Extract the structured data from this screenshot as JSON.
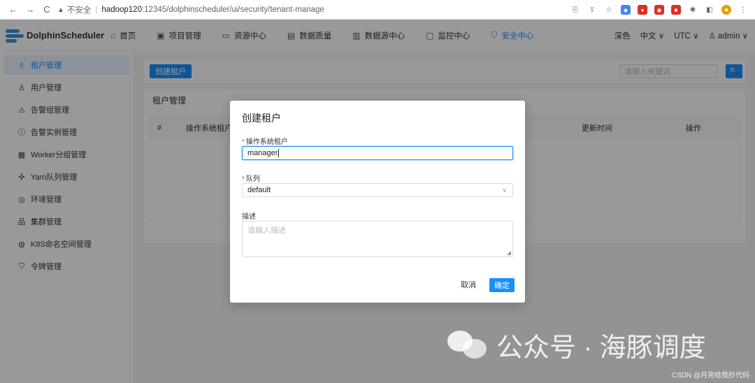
{
  "browser": {
    "back": "←",
    "forward": "→",
    "reload": "C",
    "warning_icon": "▲",
    "insecure_label": "不安全",
    "sep": "|",
    "host": "hadoop120",
    "path": ":12345/dolphinscheduler/ui/security/tenant-manage"
  },
  "header": {
    "logo": "DolphinScheduler",
    "nav": [
      {
        "icon": "home-icon",
        "glyph": "⌂",
        "label": "首页"
      },
      {
        "icon": "project-icon",
        "glyph": "▣",
        "label": "项目管理"
      },
      {
        "icon": "folder-icon",
        "glyph": "▭",
        "label": "资源中心"
      },
      {
        "icon": "quality-icon",
        "glyph": "▤",
        "label": "数据质量"
      },
      {
        "icon": "datasource-icon",
        "glyph": "▥",
        "label": "数据源中心"
      },
      {
        "icon": "monitor-icon",
        "glyph": "▢",
        "label": "监控中心"
      },
      {
        "icon": "shield-icon",
        "glyph": "⛉",
        "label": "安全中心"
      }
    ],
    "theme": "深色",
    "language": "中文",
    "timezone": "UTC",
    "user": "admin",
    "user_icon": "♙",
    "chevron": "∨"
  },
  "sidebar": {
    "items": [
      {
        "glyph": "♗",
        "label": "租户管理",
        "active": true
      },
      {
        "glyph": "♙",
        "label": "用户管理"
      },
      {
        "glyph": "⚠",
        "label": "告警组管理"
      },
      {
        "glyph": "ⓘ",
        "label": "告警实例管理"
      },
      {
        "glyph": "▦",
        "label": "Worker分组管理"
      },
      {
        "glyph": "✣",
        "label": "Yarn队列管理"
      },
      {
        "glyph": "◎",
        "label": "环境管理"
      },
      {
        "glyph": "品",
        "label": "集群管理"
      },
      {
        "glyph": "◍",
        "label": "K8S命名空间管理"
      },
      {
        "glyph": "⛉",
        "label": "令牌管理"
      }
    ]
  },
  "main": {
    "create_button": "创建租户",
    "search_placeholder": "请输入关键词",
    "search_glyph": "🔍",
    "table_title": "租户管理",
    "columns": [
      "#",
      "操作系统租户",
      "更新时间",
      "操作"
    ]
  },
  "modal": {
    "title": "创建租户",
    "req": "*",
    "tenant_label": "操作系统租户",
    "tenant_value": "manager",
    "queue_label": "队列",
    "queue_value": "default",
    "chevron": "∨",
    "desc_label": "描述",
    "desc_placeholder": "请输入描述",
    "resize": "◢",
    "cancel": "取消",
    "confirm": "确定"
  },
  "watermark": {
    "text": "公众号 · 海豚调度",
    "credit": "CSDN @月亮给我抄代码"
  },
  "colors": {
    "accent": "#1890ff"
  }
}
